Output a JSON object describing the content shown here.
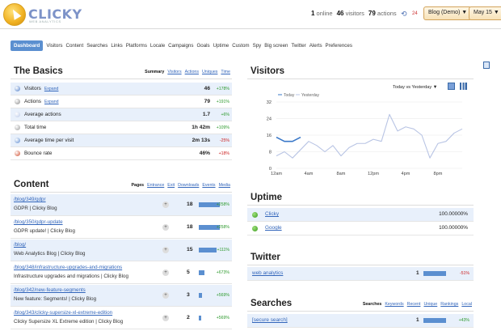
{
  "app": {
    "logo_text": "CLICKY",
    "logo_sub": "WEB ANALYTICS"
  },
  "header": {
    "online_count": "1",
    "online_label": "online",
    "visitors_count": "46",
    "visitors_label": "visitors",
    "actions_count": "79",
    "actions_label": "actions",
    "live_label": "24",
    "site_selector": "Blog (Demo) ▼",
    "date_selector": "May 15 ▼"
  },
  "nav": {
    "items": [
      "Dashboard",
      "Visitors",
      "Content",
      "Searches",
      "Links",
      "Platforms",
      "Locale",
      "Campaigns",
      "Goals",
      "Uptime",
      "Custom",
      "Spy",
      "Big screen",
      "Twitter",
      "Alerts",
      "Preferences"
    ]
  },
  "basics": {
    "title": "The Basics",
    "links": [
      "Summary",
      "Visitors",
      "Actions",
      "Uniques",
      "Time"
    ],
    "expand_label": "Expand",
    "rows": [
      {
        "label": "Visitors",
        "value": "46",
        "change": "+178%",
        "positive": true,
        "expand": true
      },
      {
        "label": "Actions",
        "value": "79",
        "change": "+191%",
        "positive": true,
        "expand": true
      },
      {
        "label": "Average actions",
        "value": "1.7",
        "change": "+6%",
        "positive": true,
        "expand": false
      },
      {
        "label": "Total time",
        "value": "1h 42m",
        "change": "+109%",
        "positive": true,
        "expand": false
      },
      {
        "label": "Average time per visit",
        "value": "2m 13s",
        "change": "-25%",
        "positive": false,
        "expand": false
      },
      {
        "label": "Bounce rate",
        "value": "46%",
        "change": "+18%",
        "positive": false,
        "expand": false
      }
    ]
  },
  "content": {
    "title": "Content",
    "links": [
      "Pages",
      "Entrance",
      "Exit",
      "Downloads",
      "Events",
      "Media"
    ],
    "rows": [
      {
        "url": "/blog/349/gdpr",
        "title": "GDPR | Clicky Blog",
        "count": "18",
        "bar": 1.0,
        "change": "+258%"
      },
      {
        "url": "/blog/350/gdpr-update",
        "title": "GDPR update! | Clicky Blog",
        "count": "18",
        "bar": 1.0,
        "change": "+258%"
      },
      {
        "url": "/blog/",
        "title": "Web Analytics Blog | Clicky Blog",
        "count": "15",
        "bar": 0.83,
        "change": "+111%"
      },
      {
        "url": "/blog/348/infrastructure-upgrades-and-migrations",
        "title": "Infrastructure upgrades and migrations | Clicky Blog",
        "count": "5",
        "bar": 0.28,
        "change": "+673%"
      },
      {
        "url": "/blog/342/new-feature-segments",
        "title": "New feature: Segments! | Clicky Blog",
        "count": "3",
        "bar": 0.17,
        "change": "+569%"
      },
      {
        "url": "/blog/343/clicky-supersize-xl-extreme-edition",
        "title": "Clicky Supersize XL Extreme edition | Clicky Blog",
        "count": "2",
        "bar": 0.11,
        "change": "+569%"
      }
    ]
  },
  "visitors_chart": {
    "title": "Visitors",
    "compare_selector": "Today vs Yesterday ▼"
  },
  "chart_data": {
    "type": "line",
    "ylim": [
      0,
      32
    ],
    "yticks": [
      "32",
      "24",
      "16",
      "8",
      "0"
    ],
    "xticks": [
      "12am",
      "4am",
      "8am",
      "12pm",
      "4pm",
      "8pm"
    ],
    "series": [
      {
        "name": "Today",
        "color": "#3a78c8",
        "x": [
          0,
          1,
          2,
          3
        ],
        "values": [
          15,
          13,
          13,
          15
        ]
      },
      {
        "name": "Yesterday",
        "color": "#b8c4e4",
        "x": [
          0,
          1,
          2,
          3,
          4,
          5,
          6,
          7,
          8,
          9,
          10,
          11,
          12,
          13,
          14,
          15,
          16,
          17,
          18,
          19,
          20,
          21,
          22,
          23
        ],
        "values": [
          6,
          8,
          5,
          9,
          13,
          11,
          8,
          11,
          6,
          10,
          12,
          12,
          14,
          13,
          26,
          18,
          20,
          19,
          16,
          5,
          12,
          13,
          17,
          19
        ]
      }
    ]
  },
  "uptime": {
    "title": "Uptime",
    "rows": [
      {
        "name": "Clicky",
        "value": "100.00000%"
      },
      {
        "name": "Google",
        "value": "100.00000%"
      }
    ]
  },
  "twitter": {
    "title": "Twitter",
    "rows": [
      {
        "term": "web analytics",
        "count": "1",
        "change": "-51%"
      }
    ]
  },
  "searches": {
    "title": "Searches",
    "links": [
      "Searches",
      "Keywords",
      "Recent",
      "Unique",
      "Rankings",
      "Local"
    ],
    "rows": [
      {
        "term": "[secure search]",
        "count": "1",
        "change": "+43%"
      }
    ]
  },
  "colors": {
    "accent": "#5b8fd0",
    "link": "#3366bb",
    "positive": "#2e9a2e",
    "negative": "#cc2222",
    "row_highlight": "#e8f0fb"
  }
}
